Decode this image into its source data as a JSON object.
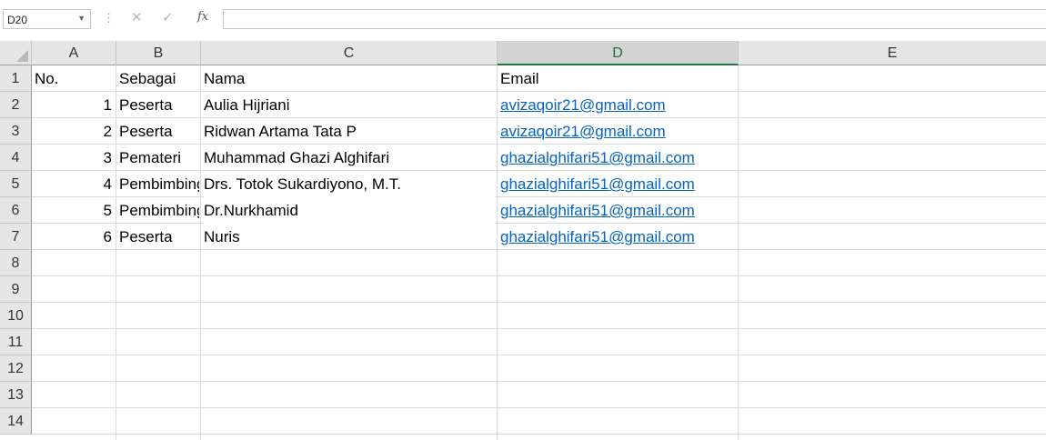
{
  "formula_bar": {
    "name_box": "D20",
    "formula": "",
    "cancel_icon": "close-icon",
    "enter_icon": "check-icon",
    "function_label": "fx"
  },
  "columns": [
    "A",
    "B",
    "C",
    "D",
    "E"
  ],
  "selected_column": "D",
  "rows": [
    "1",
    "2",
    "3",
    "4",
    "5",
    "6",
    "7",
    "8",
    "9",
    "10",
    "11",
    "12",
    "13",
    "14"
  ],
  "table": {
    "headers": {
      "a": "No.",
      "b": "Sebagai",
      "c": "Nama",
      "d": "Email"
    },
    "rows": [
      {
        "no": "1",
        "sebagai": "Peserta",
        "nama": "Aulia Hijriani",
        "email": "avizaqoir21@gmail.com"
      },
      {
        "no": "2",
        "sebagai": "Peserta",
        "nama": "Ridwan Artama Tata P",
        "email": "avizaqoir21@gmail.com"
      },
      {
        "no": "3",
        "sebagai": "Pemateri",
        "nama": "Muhammad Ghazi Alghifari",
        "email": "ghazialghifari51@gmail.com"
      },
      {
        "no": "4",
        "sebagai": "Pembimbing",
        "nama": "Drs. Totok Sukardiyono, M.T.",
        "email": "ghazialghifari51@gmail.com"
      },
      {
        "no": "5",
        "sebagai": "Pembimbing",
        "nama": "Dr.Nurkhamid",
        "email": "ghazialghifari51@gmail.com"
      },
      {
        "no": "6",
        "sebagai": "Peserta",
        "nama": "Nuris",
        "email": "ghazialghifari51@gmail.com"
      }
    ]
  },
  "colors": {
    "link": "#0563c1",
    "selected_header": "#217346",
    "gridline": "#dadcdd"
  }
}
